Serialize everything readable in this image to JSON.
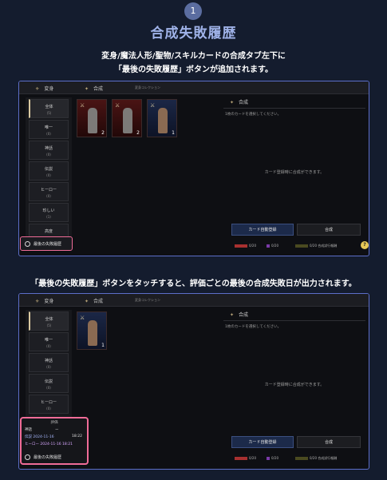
{
  "header": {
    "step": "1",
    "title": "合成失敗履歴",
    "description_line1": "変身/魔法人形/聖物/スキルカードの合成タブ左下に",
    "description_line2": "「最後の失敗履歴」ボタンが追加されます。",
    "description_line3": "「最後の失敗履歴」ボタンをタッチすると、評価ごとの最後の合成失敗日が出力されます。"
  },
  "game_ui": {
    "tabs": [
      "変身",
      "合成",
      "変身コレクション"
    ],
    "categories": [
      {
        "name": "全体",
        "count": "(5)"
      },
      {
        "name": "唯一",
        "count": "(0)"
      },
      {
        "name": "神話",
        "count": "(0)"
      },
      {
        "name": "伝説",
        "count": "(0)"
      },
      {
        "name": "ヒーロー",
        "count": "(0)"
      },
      {
        "name": "珍しい",
        "count": "(1)"
      },
      {
        "name": "高度",
        "count": ""
      }
    ],
    "history_button": "最後の失敗履歴",
    "right_header": "合成",
    "right_subtitle": "1枚のカードを選択してください。",
    "right_message": "カード登録時に合成ができます。",
    "auto_register_button": "カード自動登録",
    "synthesize_button": "合成",
    "status_1": "0/20",
    "status_2": "0/20",
    "status_3": "0/20 合成試行報酬",
    "cards_panel1": [
      {
        "count": "2",
        "bg": "#4a1414"
      },
      {
        "count": "2",
        "bg": "#4a1414"
      },
      {
        "count": "1",
        "bg": "#1b2746"
      }
    ],
    "cards_panel2": [
      {
        "count": "1",
        "bg": "#1b2746"
      }
    ],
    "history_popup": {
      "grade_header": "評価",
      "row1_label": "神話",
      "row1_value": "ー",
      "row2_label": "伝説 2024-11-16",
      "row2_value": "18:22",
      "row3_label": "ヒーロー 2024-11-16 18:21"
    }
  },
  "colors": {
    "accent": "#9fb2e8",
    "highlight_border": "#f06c98",
    "panel_border": "#5c6ec8"
  }
}
